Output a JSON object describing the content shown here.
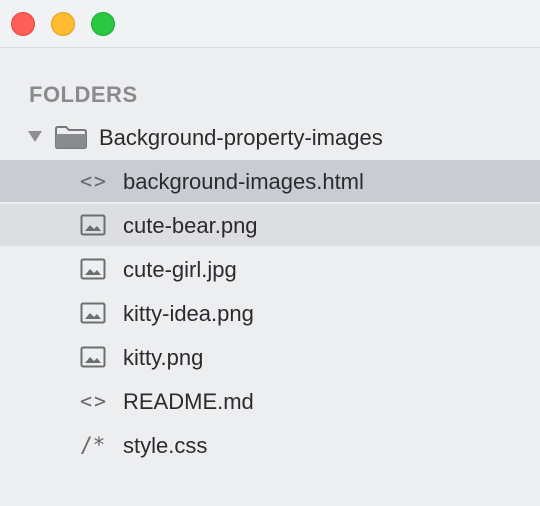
{
  "window": {
    "buttons": [
      "close",
      "minimize",
      "zoom"
    ]
  },
  "sidebar": {
    "section_title": "FOLDERS",
    "folder": {
      "name": "Background-property-images",
      "expanded": true,
      "icon": "folder-icon"
    },
    "files": [
      {
        "name": "background-images.html",
        "icon": "code-icon",
        "state": "selected"
      },
      {
        "name": "cute-bear.png",
        "icon": "image-icon",
        "state": "hover"
      },
      {
        "name": "cute-girl.jpg",
        "icon": "image-icon",
        "state": ""
      },
      {
        "name": "kitty-idea.png",
        "icon": "image-icon",
        "state": ""
      },
      {
        "name": "kitty.png",
        "icon": "image-icon",
        "state": ""
      },
      {
        "name": "README.md",
        "icon": "code-icon",
        "state": ""
      },
      {
        "name": "style.css",
        "icon": "comment-icon",
        "state": ""
      }
    ]
  }
}
